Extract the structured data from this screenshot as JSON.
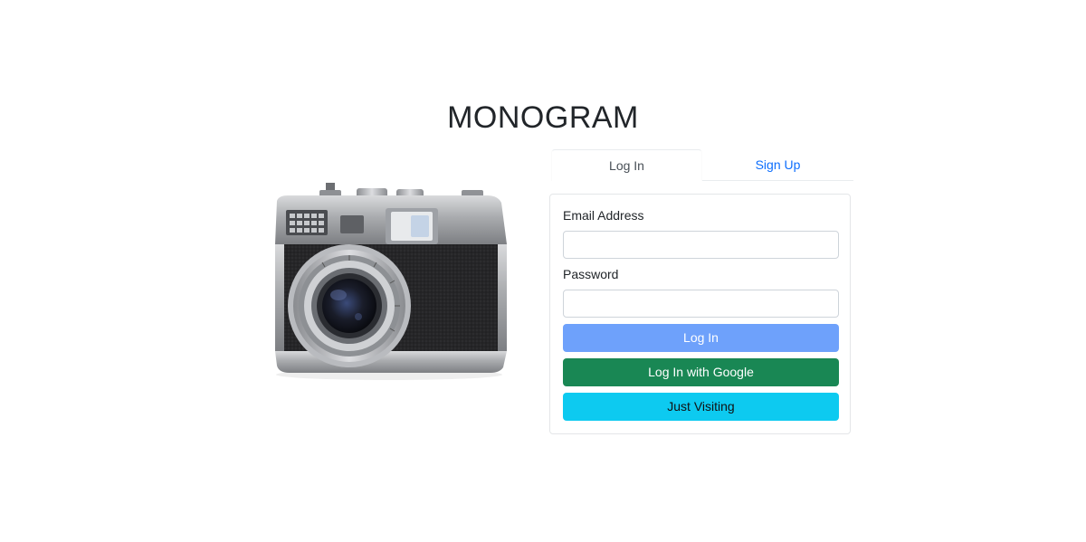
{
  "app": {
    "title": "MONOGRAM"
  },
  "image": {
    "icon": "vintage-camera"
  },
  "tabs": [
    {
      "label": "Log In",
      "active": true
    },
    {
      "label": "Sign Up",
      "active": false
    }
  ],
  "form": {
    "email_label": "Email Address",
    "email_value": "",
    "password_label": "Password",
    "password_value": "",
    "login_button": "Log In",
    "google_button": "Log In with Google",
    "visit_button": "Just Visiting"
  },
  "colors": {
    "primary_disabled": "#6ea1fb",
    "success": "#198754",
    "info": "#0dcaf0",
    "link": "#0d6efd"
  }
}
